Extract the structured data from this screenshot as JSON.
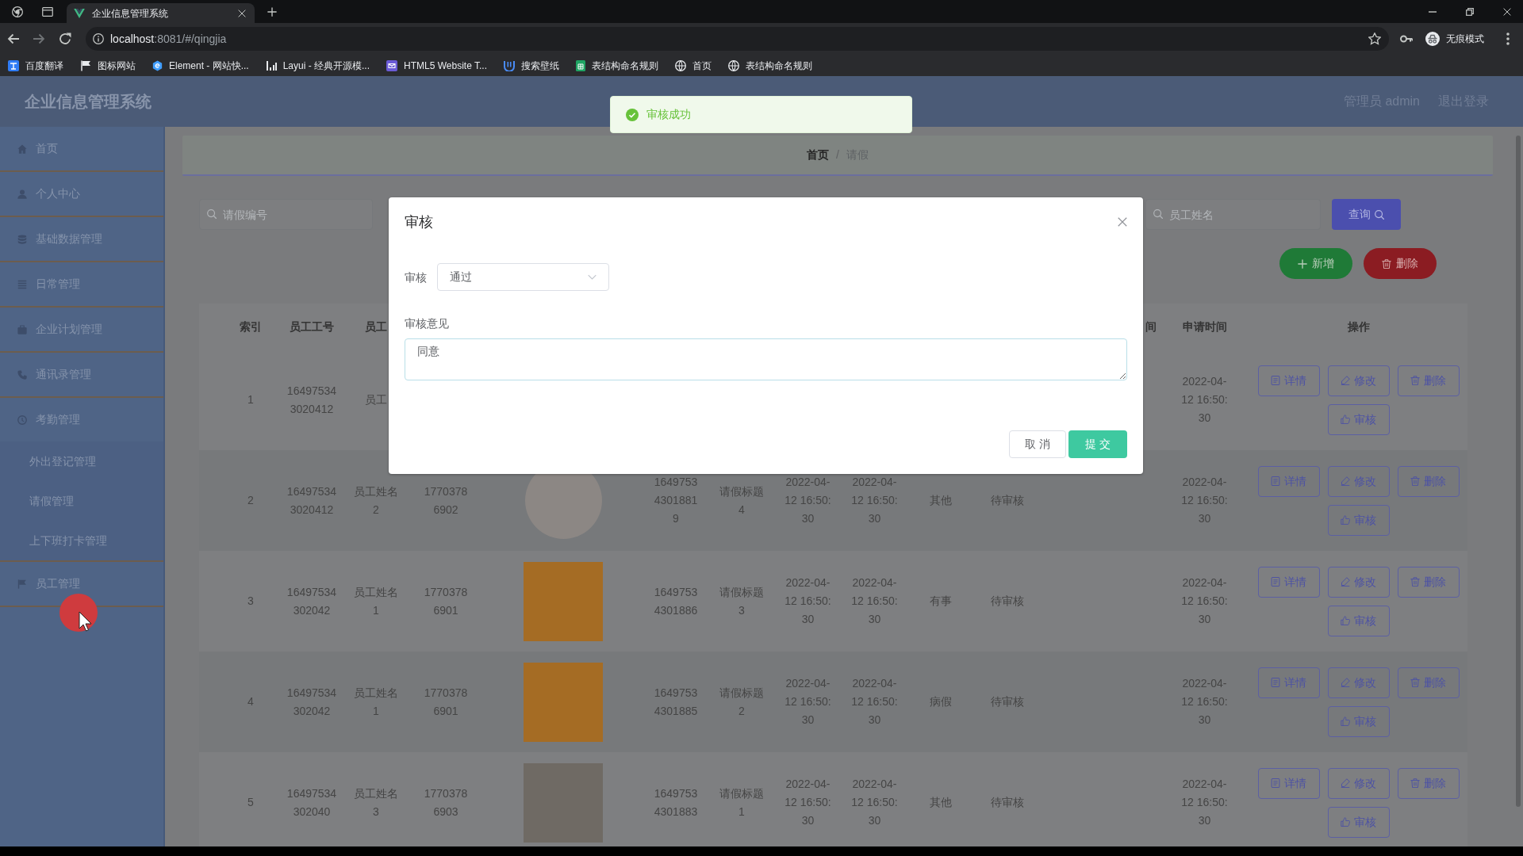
{
  "browser": {
    "tabs": [
      {
        "title": "企业信息管理系统",
        "selected": true
      }
    ],
    "url": {
      "host": "localhost",
      "path": ":8081/#/qingjia"
    },
    "profile": "无痕模式",
    "bookmarks": [
      {
        "kind": "tile",
        "label": "百度翻译"
      },
      {
        "kind": "flag",
        "label": "图标网站"
      },
      {
        "kind": "hexagon",
        "label": "Element - 网站快..."
      },
      {
        "kind": "bars",
        "label": "Layui - 经典开源模..."
      },
      {
        "kind": "envelope",
        "label": "HTML5 Website T..."
      },
      {
        "kind": "u",
        "label": "搜索壁纸"
      },
      {
        "kind": "sheet",
        "label": "表结构命名规则"
      },
      {
        "kind": "globe",
        "label": "首页"
      },
      {
        "kind": "globe",
        "label": "表结构命名规则"
      }
    ]
  },
  "header": {
    "title": "企业信息管理系统",
    "user": "管理员 admin",
    "logout": "退出登录"
  },
  "sidebar": {
    "items": [
      {
        "label": "首页",
        "kind": "home"
      },
      {
        "label": "个人中心",
        "kind": "user"
      },
      {
        "label": "基础数据管理",
        "kind": "database"
      },
      {
        "label": "日常管理",
        "kind": "list"
      },
      {
        "label": "企业计划管理",
        "kind": "briefcase"
      },
      {
        "label": "通讯录管理",
        "kind": "phone"
      },
      {
        "label": "考勤管理",
        "kind": "clock",
        "expanded": true,
        "children": [
          {
            "label": "外出登记管理"
          },
          {
            "label": "请假管理"
          },
          {
            "label": "上下班打卡管理"
          }
        ]
      },
      {
        "label": "员工管理",
        "kind": "flag"
      }
    ]
  },
  "breadcrumb": {
    "separator": "/",
    "items": [
      {
        "label": "首页",
        "current": false
      },
      {
        "label": "请假",
        "current": true
      }
    ]
  },
  "search": {
    "fields": [
      {
        "placeholder": "请假编号"
      },
      {
        "placeholder": "员工姓名"
      }
    ],
    "button": "查询"
  },
  "toolbar": [
    {
      "kind": "add",
      "label": "新增"
    },
    {
      "kind": "delete",
      "label": "删除"
    }
  ],
  "table": {
    "columns": [
      "索引",
      "员工工号",
      "员工",
      null,
      null,
      null,
      null,
      null,
      null,
      null,
      null,
      null,
      "间",
      "申请时间",
      "操作"
    ],
    "rows": [
      {
        "cells": [
          "1",
          "164975343020412",
          "员工",
          null,
          null,
          null,
          null,
          null,
          null,
          null,
          null,
          null,
          null,
          "2022-04-12 16:50:30"
        ],
        "actions": [
          {
            "kind": "detail",
            "label": "详情"
          },
          {
            "kind": "edit",
            "label": "修改"
          },
          {
            "kind": "delete",
            "label": "删除"
          },
          {
            "kind": "review",
            "label": "审核"
          }
        ]
      },
      {
        "cells": [
          "2",
          "164975343020412",
          "员工姓名2",
          "17703786902",
          {
            "kind": "round"
          },
          "164975343018819",
          "请假标题4",
          "2022-04-12 16:50:30",
          "2022-04-12 16:50:30",
          "其他",
          "待审核",
          null,
          null,
          "2022-04-12 16:50:30"
        ],
        "actions": [
          {
            "kind": "detail",
            "label": "详情"
          },
          {
            "kind": "edit",
            "label": "修改"
          },
          {
            "kind": "delete",
            "label": "删除"
          },
          {
            "kind": "review",
            "label": "审核"
          }
        ]
      },
      {
        "cells": [
          "3",
          "16497534302042",
          "员工姓名1",
          "17703786901",
          {
            "kind": "cartoon"
          },
          "16497534301886",
          "请假标题3",
          "2022-04-12 16:50:30",
          "2022-04-12 16:50:30",
          "有事",
          "待审核",
          null,
          null,
          "2022-04-12 16:50:30"
        ],
        "actions": [
          {
            "kind": "detail",
            "label": "详情"
          },
          {
            "kind": "edit",
            "label": "修改"
          },
          {
            "kind": "delete",
            "label": "删除"
          },
          {
            "kind": "review",
            "label": "审核"
          }
        ]
      },
      {
        "cells": [
          "4",
          "16497534302042",
          "员工姓名1",
          "17703786901",
          {
            "kind": "cartoon"
          },
          "16497534301885",
          "请假标题2",
          "2022-04-12 16:50:30",
          "2022-04-12 16:50:30",
          "病假",
          "待审核",
          null,
          null,
          "2022-04-12 16:50:30"
        ],
        "actions": [
          {
            "kind": "detail",
            "label": "详情"
          },
          {
            "kind": "edit",
            "label": "修改"
          },
          {
            "kind": "delete",
            "label": "删除"
          },
          {
            "kind": "review",
            "label": "审核"
          }
        ]
      },
      {
        "cells": [
          "5",
          "16497534302040",
          "员工姓名3",
          "17703786903",
          {
            "kind": "photo"
          },
          "16497534301883",
          "请假标题1",
          "2022-04-12 16:50:30",
          "2022-04-12 16:50:30",
          "其他",
          "待审核",
          null,
          null,
          "2022-04-12 16:50:30"
        ],
        "actions": [
          {
            "kind": "detail",
            "label": "详情"
          },
          {
            "kind": "edit",
            "label": "修改"
          },
          {
            "kind": "delete",
            "label": "删除"
          },
          {
            "kind": "review",
            "label": "审核"
          }
        ]
      }
    ]
  },
  "toast": {
    "kind": "success",
    "text": "审核成功"
  },
  "dialog": {
    "title": "审核",
    "fields": [
      {
        "kind": "select",
        "label": "审核",
        "value": "通过"
      },
      {
        "kind": "textarea",
        "label": "审核意见",
        "value": "同意"
      }
    ],
    "buttons": [
      {
        "kind": "cancel",
        "label": "取消"
      },
      {
        "kind": "submit",
        "label": "提交"
      }
    ]
  }
}
